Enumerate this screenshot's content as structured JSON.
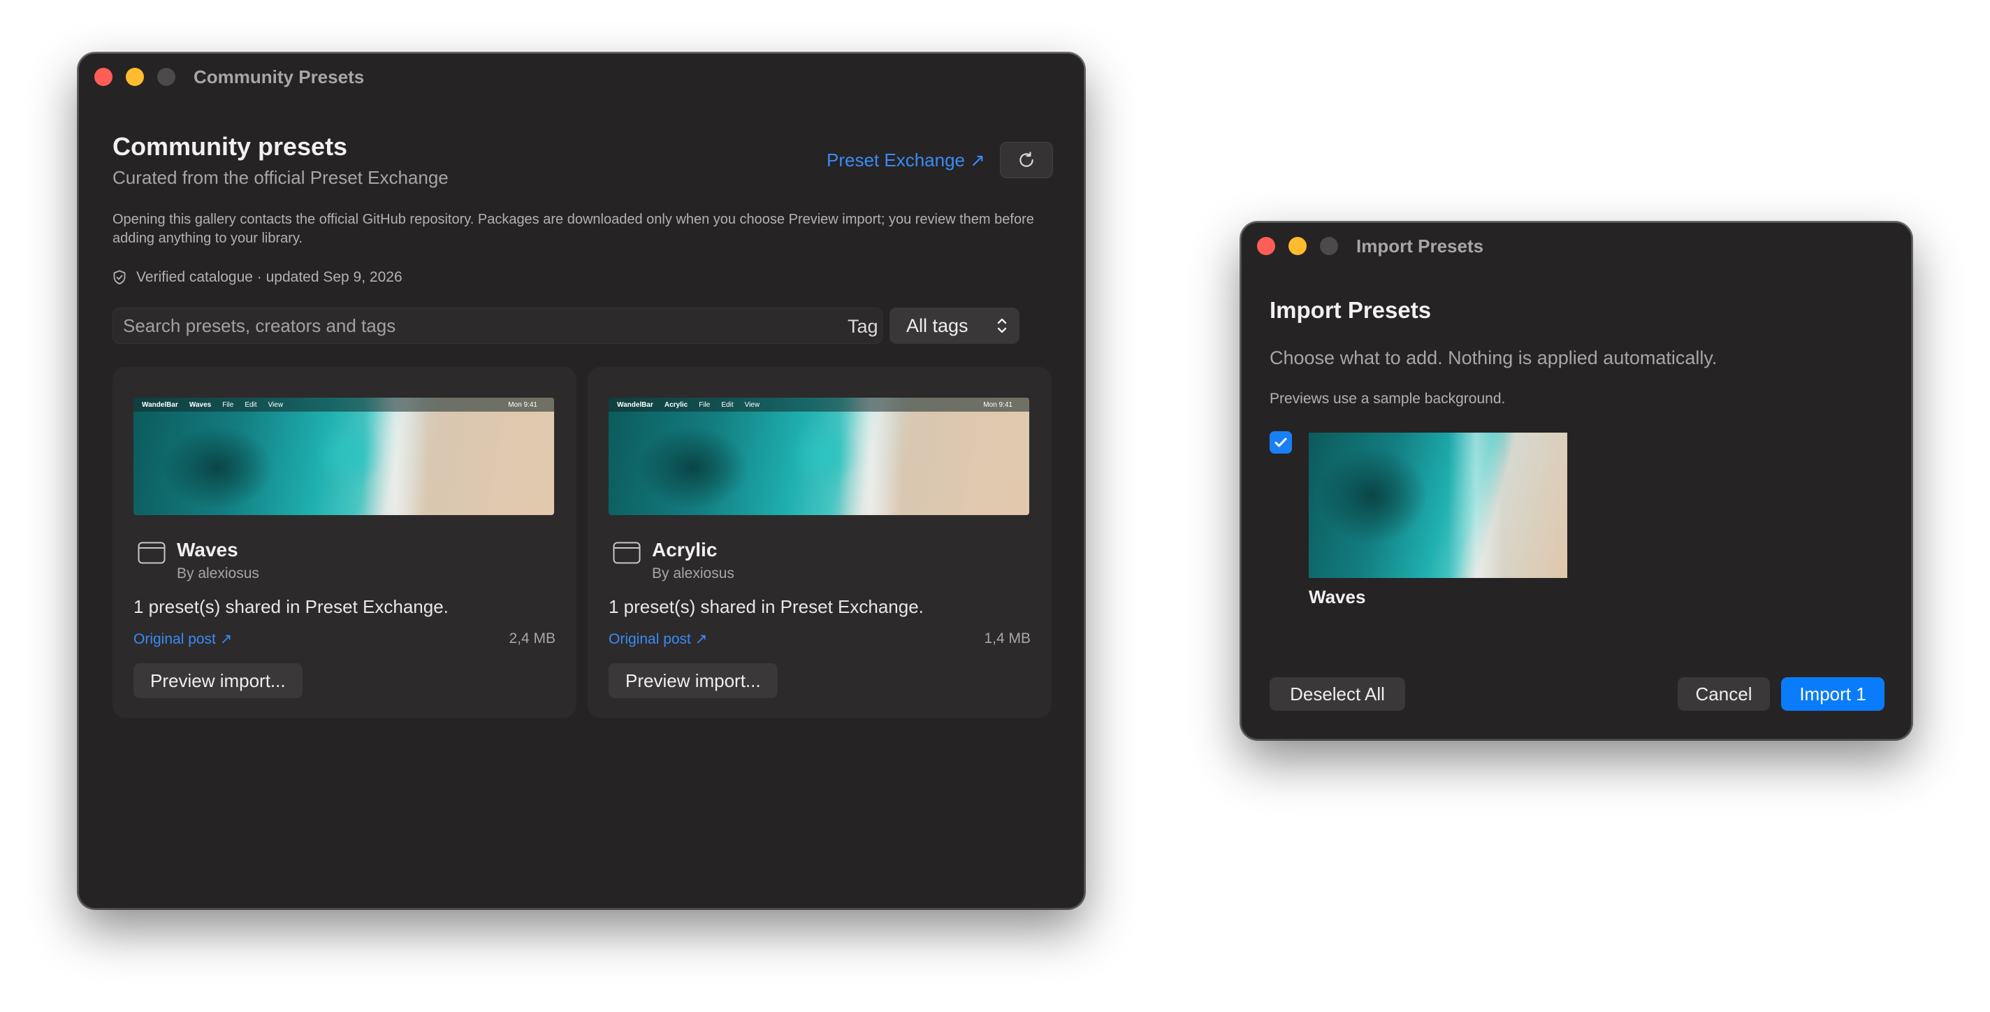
{
  "community_window": {
    "title": "Community Presets",
    "heading": "Community presets",
    "subheading": "Curated from the official Preset Exchange",
    "exchange_link": "Preset Exchange ↗",
    "notice": "Opening this gallery contacts the official GitHub repository. Packages are downloaded only when you choose Preview import; you review them before adding anything to your library.",
    "verified": "Verified catalogue · updated Sep 9, 2026",
    "search_placeholder": "Search presets, creators and tags",
    "tag_label": "Tag",
    "tag_value": "All tags",
    "presets": [
      {
        "name": "Waves",
        "author": "By alexiosus",
        "description": "1 preset(s) shared in Preset Exchange.",
        "link": "Original post ↗",
        "size": "2,4 MB",
        "button": "Preview import...",
        "menubar": {
          "app": "WandelBar",
          "name": "Waves",
          "file": "File",
          "edit": "Edit",
          "view": "View",
          "clock": "Mon 9:41"
        }
      },
      {
        "name": "Acrylic",
        "author": "By alexiosus",
        "description": "1 preset(s) shared in Preset Exchange.",
        "link": "Original post ↗",
        "size": "1,4 MB",
        "button": "Preview import...",
        "menubar": {
          "app": "WandelBar",
          "name": "Acrylic",
          "file": "File",
          "edit": "Edit",
          "view": "View",
          "clock": "Mon 9:41"
        }
      }
    ]
  },
  "import_window": {
    "title": "Import Presets",
    "heading": "Import Presets",
    "subheading": "Choose what to add. Nothing is applied automatically.",
    "note": "Previews use a sample background.",
    "item": {
      "name": "Waves",
      "checked": true
    },
    "deselect_label": "Deselect All",
    "cancel_label": "Cancel",
    "import_label": "Import 1"
  },
  "colors": {
    "accent": "#0a7cfa",
    "link": "#3a8bf5",
    "window_bg": "#262324"
  },
  "icons": {
    "refresh": "refresh-icon",
    "shield": "shield-check-icon",
    "chevron": "chevron-up-down-icon",
    "preset": "window-icon",
    "check": "checkmark-icon"
  }
}
